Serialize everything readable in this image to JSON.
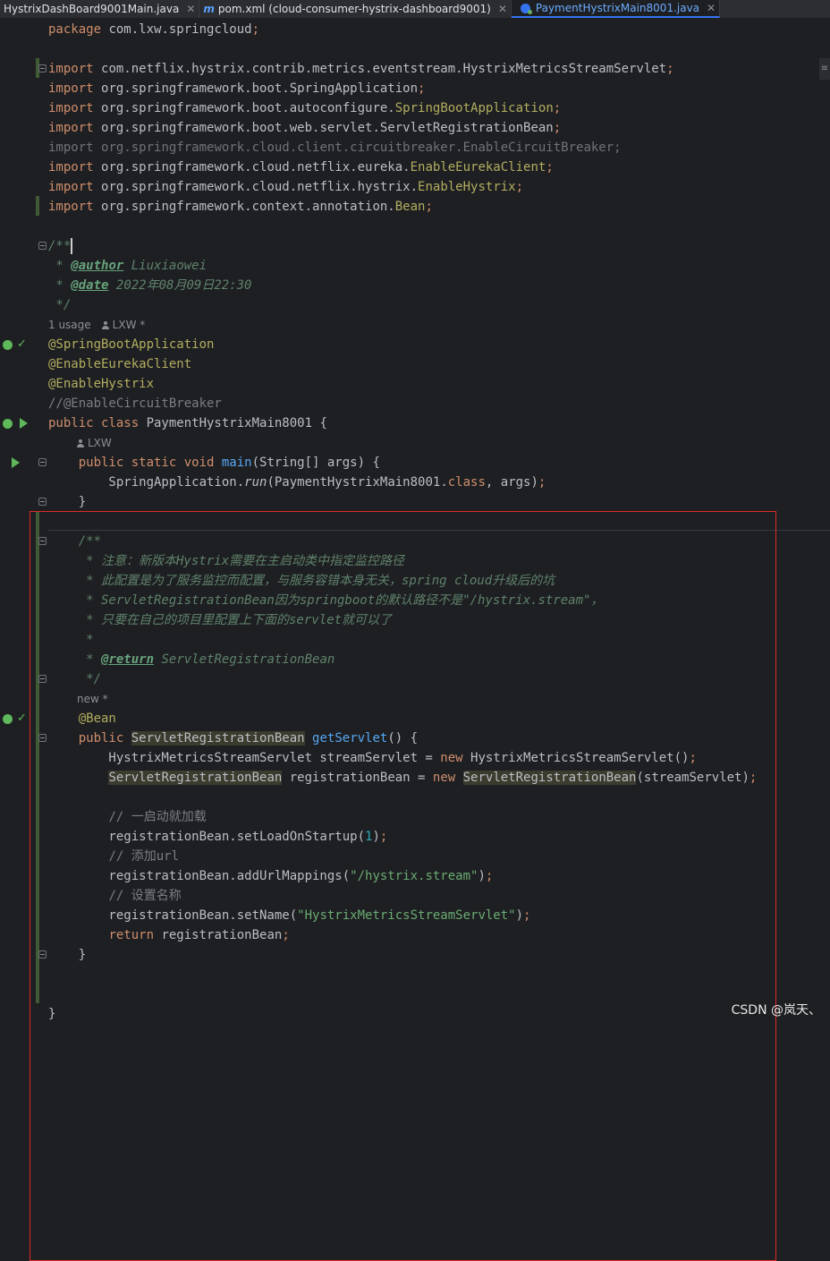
{
  "tabs": [
    {
      "label": "HystrixDashBoard9001Main.java",
      "active": false
    },
    {
      "label": "pom.xml (cloud-consumer-hystrix-dashboard9001)",
      "active": false
    },
    {
      "label": "PaymentHystrixMain8001.java",
      "active": true
    }
  ],
  "code": {
    "package": "com.lxw.springcloud",
    "imports": [
      "com.netflix.hystrix.contrib.metrics.eventstream.HystrixMetricsStreamServlet",
      "org.springframework.boot.SpringApplication",
      "org.springframework.boot.autoconfigure.SpringBootApplication",
      "org.springframework.boot.web.servlet.ServletRegistrationBean",
      "org.springframework.cloud.client.circuitbreaker.EnableCircuitBreaker",
      "org.springframework.cloud.netflix.eureka.EnableEurekaClient",
      "org.springframework.cloud.netflix.hystrix.EnableHystrix",
      "org.springframework.context.annotation.Bean"
    ],
    "javadoc_author": "Liuxiaowei",
    "javadoc_date": "2022年08月09日22:30",
    "class_name": "PaymentHystrixMain8001",
    "annotations": [
      "@SpringBootApplication",
      "@EnableEurekaClient",
      "@EnableHystrix",
      "//@EnableCircuitBreaker"
    ],
    "bean_doc": [
      " * 注意：新版本Hystrix需要在主启动类中指定监控路径",
      " * 此配置是为了服务监控而配置，与服务容错本身无关，spring cloud升级后的坑",
      " * ServletRegistrationBean因为springboot的默认路径不是\"/hystrix.stream\"，",
      " * 只要在自己的项目里配置上下面的servlet就可以了"
    ],
    "return_doc": "ServletRegistrationBean",
    "comment_load": "// 一启动就加载",
    "comment_url": "// 添加url",
    "comment_name": "// 设置名称",
    "load_on_startup": "1",
    "url_mapping": "\"/hystrix.stream\"",
    "servlet_name": "\"HystrixMetricsStreamServlet\""
  },
  "hints": {
    "usage": "1 usage",
    "author1": "LXW *",
    "author2": "LXW",
    "new_hint": "new *"
  },
  "watermark": "CSDN @岚天、"
}
